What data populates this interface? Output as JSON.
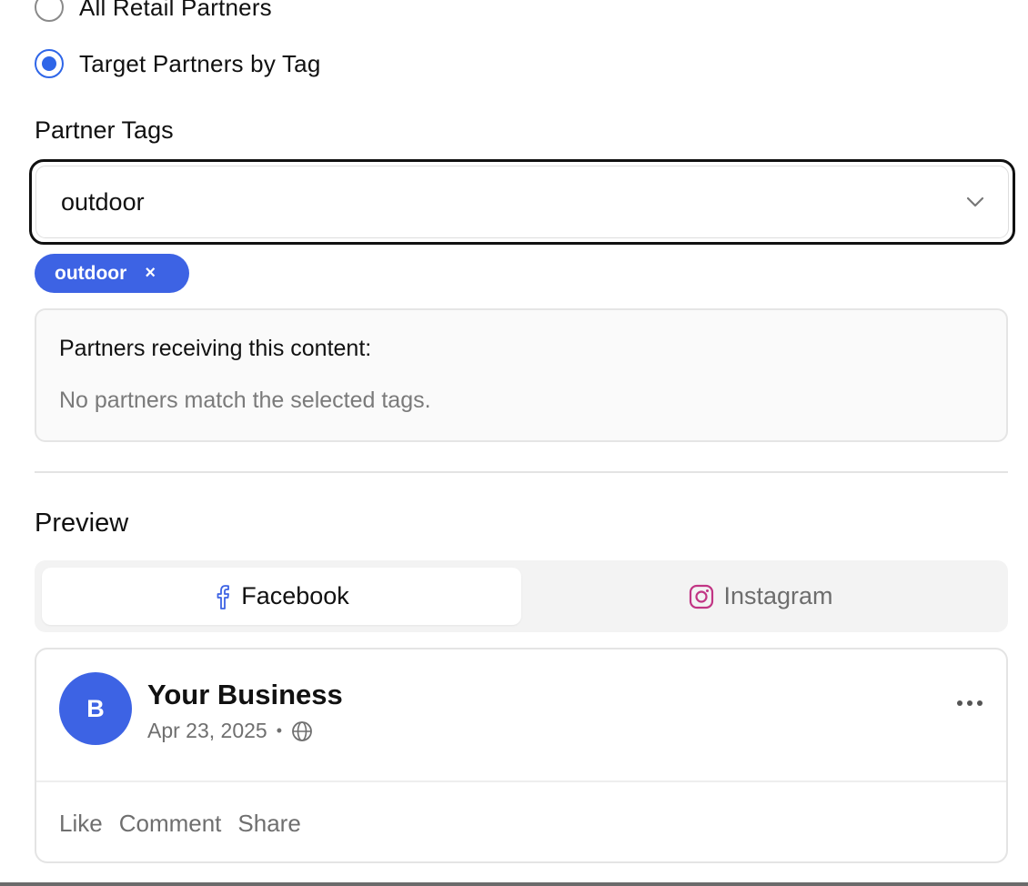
{
  "audience": {
    "options": [
      {
        "label": "All Retail Partners",
        "selected": false
      },
      {
        "label": "Target Partners by Tag",
        "selected": true
      }
    ]
  },
  "partner_tags": {
    "label": "Partner Tags",
    "select_value": "outdoor",
    "chips": [
      {
        "label": "outdoor",
        "remove": "×"
      }
    ]
  },
  "partners_box": {
    "title": "Partners receiving this content:",
    "empty_message": "No partners match the selected tags."
  },
  "preview": {
    "title": "Preview",
    "tabs": [
      {
        "label": "Facebook",
        "icon": "facebook-icon",
        "active": true
      },
      {
        "label": "Instagram",
        "icon": "instagram-icon",
        "active": false
      }
    ],
    "post": {
      "avatar_initial": "B",
      "business_name": "Your Business",
      "date": "Apr 23, 2025",
      "separator": "•",
      "visibility_icon": "globe-icon",
      "actions": [
        "Like",
        "Comment",
        "Share"
      ]
    }
  },
  "colors": {
    "accent": "#3d63e4",
    "radio_checked": "#2f66e8",
    "instagram": "#c13584"
  }
}
